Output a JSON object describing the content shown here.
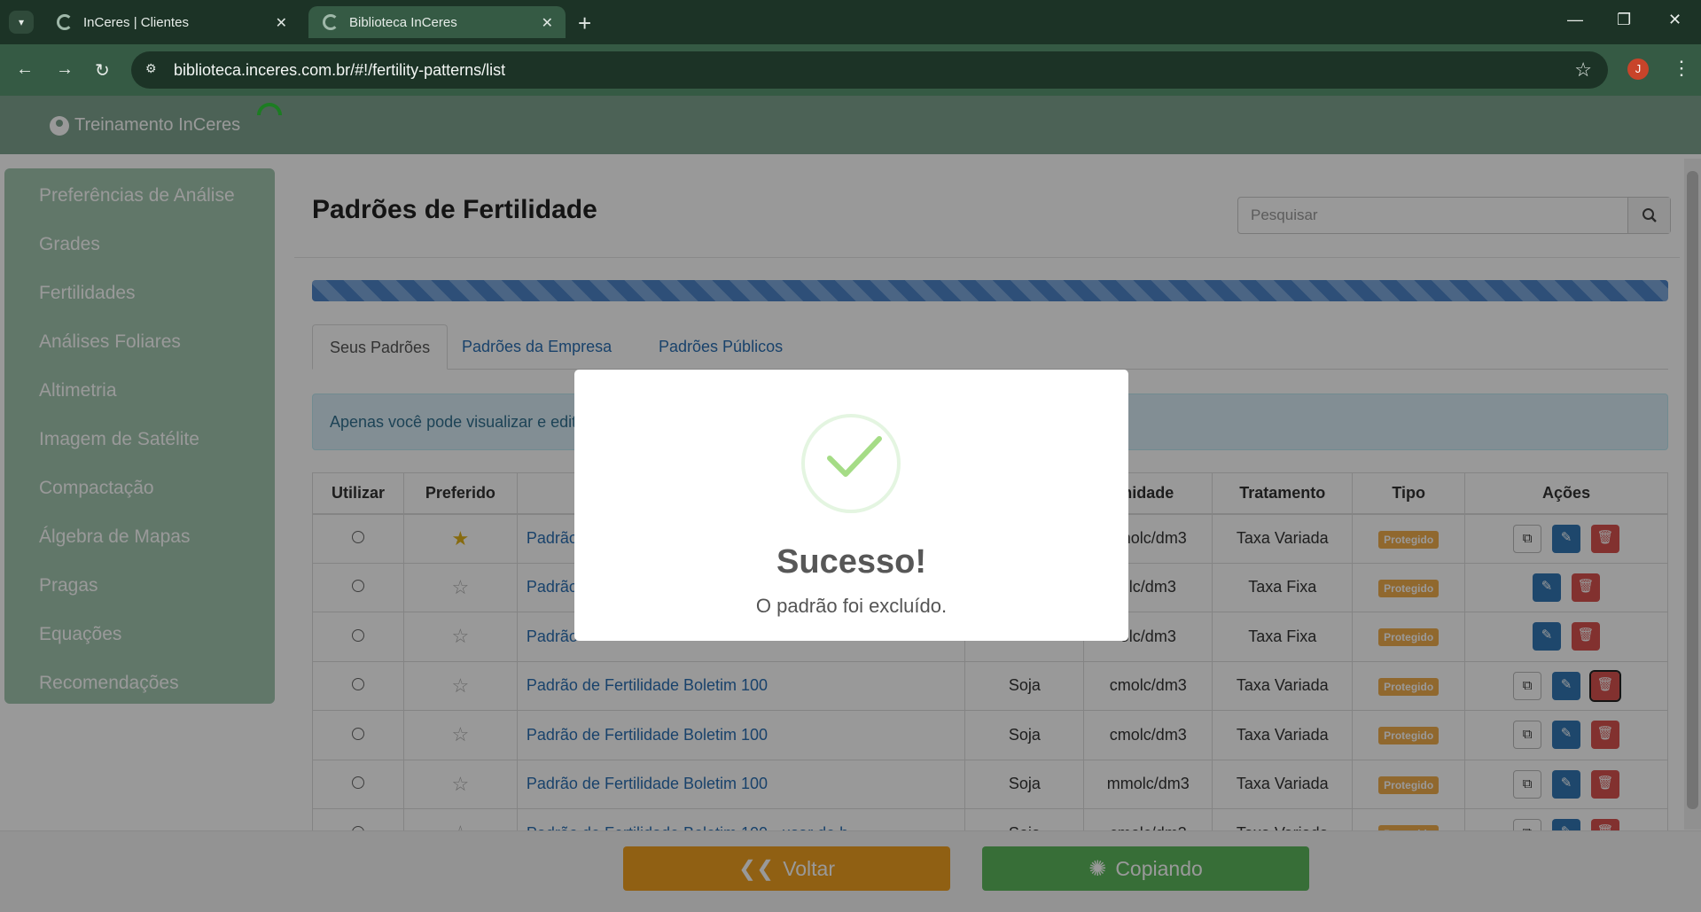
{
  "browser": {
    "tabs": [
      {
        "title": "InCeres | Clientes",
        "active": false
      },
      {
        "title": "Biblioteca InCeres",
        "active": true
      }
    ],
    "url": "biblioteca.inceres.com.br/#!/fertility-patterns/list",
    "profile_initial": "J"
  },
  "header": {
    "user_name": "Treinamento InCeres"
  },
  "sidebar": {
    "items": [
      {
        "label": "Preferências de Análise"
      },
      {
        "label": "Grades"
      },
      {
        "label": "Fertilidades"
      },
      {
        "label": "Análises Foliares"
      },
      {
        "label": "Altimetria"
      },
      {
        "label": "Imagem de Satélite"
      },
      {
        "label": "Compactação"
      },
      {
        "label": "Álgebra de Mapas"
      },
      {
        "label": "Pragas"
      },
      {
        "label": "Equações"
      },
      {
        "label": "Recomendações"
      }
    ]
  },
  "main": {
    "title": "Padrões de Fertilidade",
    "search_placeholder": "Pesquisar",
    "tabs": [
      {
        "label": "Seus Padrões",
        "active": true
      },
      {
        "label": "Padrões da Empresa",
        "active": false
      },
      {
        "label": "Padrões Públicos",
        "active": false
      }
    ],
    "alert": "Apenas você pode visualizar e edita",
    "table": {
      "headers": [
        "Utilizar",
        "Preferido",
        "",
        "",
        "nidade",
        "Tratamento",
        "Tipo",
        "Ações"
      ],
      "rows": [
        {
          "name": "Padrão",
          "culture": "",
          "unit": "cmolc/dm3",
          "treatment": "Taxa Variada",
          "type": "Protegido",
          "preferred": true,
          "has_copy": true
        },
        {
          "name": "Padrão",
          "culture": "",
          "unit": "olc/dm3",
          "treatment": "Taxa Fixa",
          "type": "Protegido",
          "preferred": false,
          "has_copy": false
        },
        {
          "name": "Padrão",
          "culture": "",
          "unit": "olc/dm3",
          "treatment": "Taxa Fixa",
          "type": "Protegido",
          "preferred": false,
          "has_copy": false
        },
        {
          "name": "Padrão de Fertilidade Boletim 100",
          "culture": "Soja",
          "unit": "cmolc/dm3",
          "treatment": "Taxa Variada",
          "type": "Protegido",
          "preferred": false,
          "has_copy": true
        },
        {
          "name": "Padrão de Fertilidade Boletim 100",
          "culture": "Soja",
          "unit": "cmolc/dm3",
          "treatment": "Taxa Variada",
          "type": "Protegido",
          "preferred": false,
          "has_copy": true
        },
        {
          "name": "Padrão de Fertilidade Boletim 100",
          "culture": "Soja",
          "unit": "mmolc/dm3",
          "treatment": "Taxa Variada",
          "type": "Protegido",
          "preferred": false,
          "has_copy": true
        },
        {
          "name": "Padrão de Fertilidade Boletim 100 - usar de b",
          "culture": "Soja",
          "unit": "cmolc/dm3",
          "treatment": "Taxa Variada",
          "type": "Protegido",
          "preferred": false,
          "has_copy": true
        }
      ]
    }
  },
  "footer": {
    "back_label": "Voltar",
    "copying_label": "Copiando"
  },
  "modal": {
    "title": "Sucesso!",
    "message": "O padrão foi excluído."
  },
  "colors": {
    "header_green": "#7fa48f",
    "sidebar_green": "#a2c7b0",
    "link_blue": "#2a6fb3",
    "badge_orange": "#f0ad4e",
    "delete_red": "#d9534f",
    "edit_blue": "#3277b4",
    "success_green": "#a5dc86"
  }
}
